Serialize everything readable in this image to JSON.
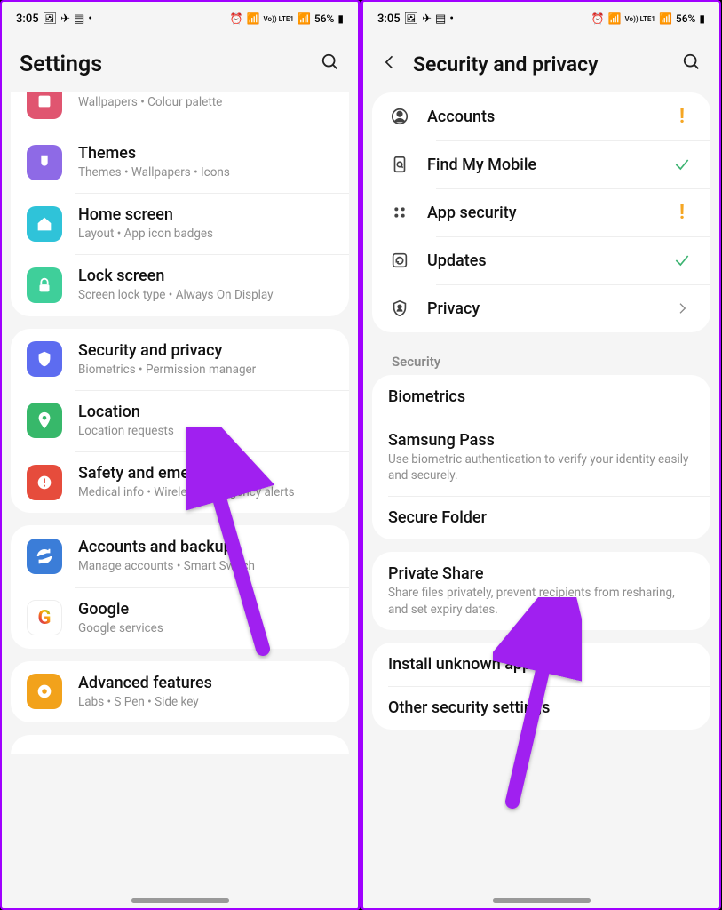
{
  "statusbar": {
    "time": "3:05",
    "battery": "56%",
    "lte": "Vo)) LTE1",
    "battery_icon": "🔋"
  },
  "left": {
    "title": "Settings",
    "items": [
      {
        "title": "",
        "sub": "Wallpapers  •  Colour palette",
        "color": "#e05570"
      },
      {
        "title": "Themes",
        "sub": "Themes  •  Wallpapers  •  Icons",
        "color": "#8e6ae6"
      },
      {
        "title": "Home screen",
        "sub": "Layout  •  App icon badges",
        "color": "#2fc3d9"
      },
      {
        "title": "Lock screen",
        "sub": "Screen lock type  •  Always On Display",
        "color": "#3fcf9a"
      },
      {
        "title": "Security and privacy",
        "sub": "Biometrics  •  Permission manager",
        "color": "#5d6cf0"
      },
      {
        "title": "Location",
        "sub": "Location requests",
        "color": "#37b86a"
      },
      {
        "title": "Safety and emergency",
        "sub": "Medical info  •  Wireless emergency alerts",
        "color": "#e64c3c"
      },
      {
        "title": "Accounts and backup",
        "sub": "Manage accounts  •  Smart Switch",
        "color": "#3b7dd8"
      },
      {
        "title": "Google",
        "sub": "Google services",
        "color": "#ffffff"
      },
      {
        "title": "Advanced features",
        "sub": "Labs  •  S Pen  •  Side key",
        "color": "#f2a21b"
      }
    ]
  },
  "right": {
    "title": "Security and privacy",
    "top_items": [
      {
        "title": "Accounts",
        "trailing": "warn"
      },
      {
        "title": "Find My Mobile",
        "trailing": "check"
      },
      {
        "title": "App security",
        "trailing": "warn"
      },
      {
        "title": "Updates",
        "trailing": "check"
      },
      {
        "title": "Privacy",
        "trailing": "chev"
      }
    ],
    "section_label": "Security",
    "security_items": [
      {
        "title": "Biometrics",
        "sub": ""
      },
      {
        "title": "Samsung Pass",
        "sub": "Use biometric authentication to verify your identity easily and securely."
      },
      {
        "title": "Secure Folder",
        "sub": ""
      }
    ],
    "private_share": {
      "title": "Private Share",
      "sub": "Share files privately, prevent recipients from resharing, and set expiry dates."
    },
    "bottom_items": [
      {
        "title": "Install unknown apps"
      },
      {
        "title": "Other security settings"
      }
    ]
  }
}
